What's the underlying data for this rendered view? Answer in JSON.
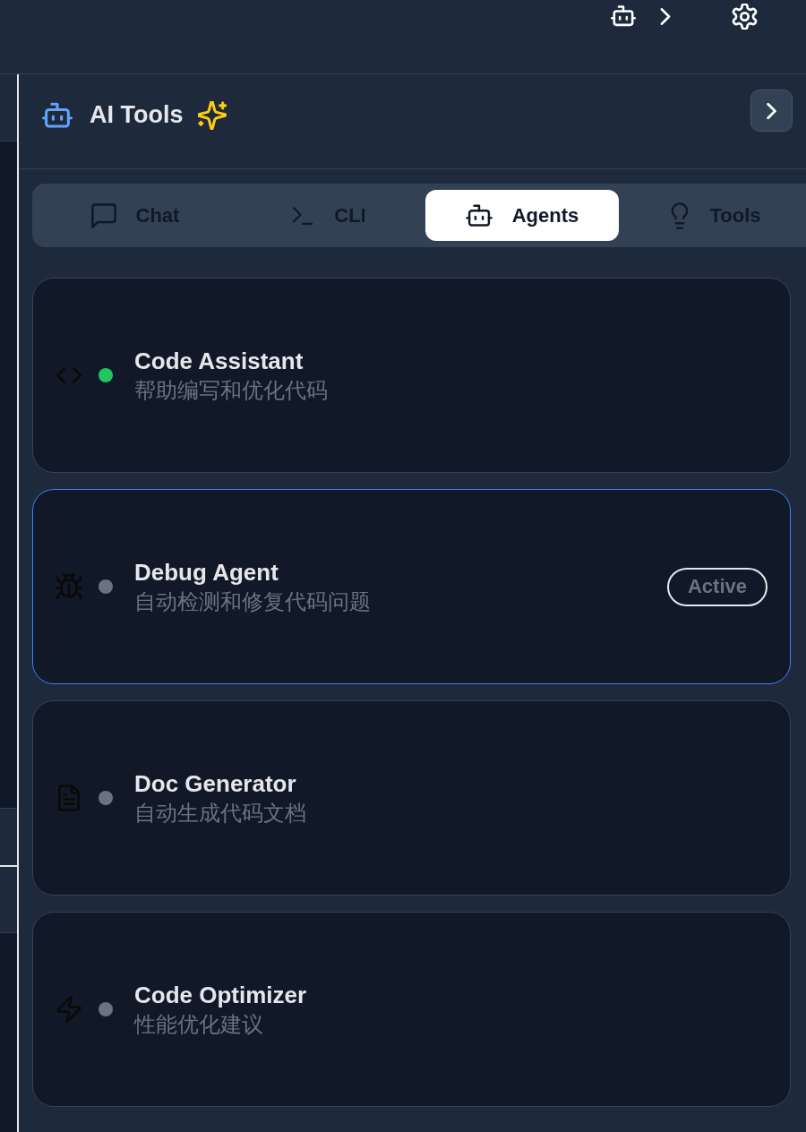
{
  "panel": {
    "title": "AI Tools"
  },
  "tabs": [
    {
      "kind": "chat",
      "label": "Chat",
      "selected": false
    },
    {
      "kind": "cli",
      "label": "CLI",
      "selected": false
    },
    {
      "kind": "agents",
      "label": "Agents",
      "selected": true
    },
    {
      "kind": "tools",
      "label": "Tools",
      "selected": false
    }
  ],
  "agents": [
    {
      "kind": "code",
      "name": "Code Assistant",
      "description": "帮助编写和优化代码",
      "color": "#22c55e",
      "selected": false
    },
    {
      "kind": "debug",
      "name": "Debug Agent",
      "description": "自动检测和修复代码问题",
      "color": "#6b7280",
      "selected": true,
      "badge": "Active"
    },
    {
      "kind": "doc",
      "name": "Doc Generator",
      "description": "自动生成代码文档",
      "color": "#6b7280",
      "selected": false
    },
    {
      "kind": "optimize",
      "name": "Code Optimizer",
      "description": "性能优化建议",
      "color": "#6b7280",
      "selected": false
    }
  ]
}
